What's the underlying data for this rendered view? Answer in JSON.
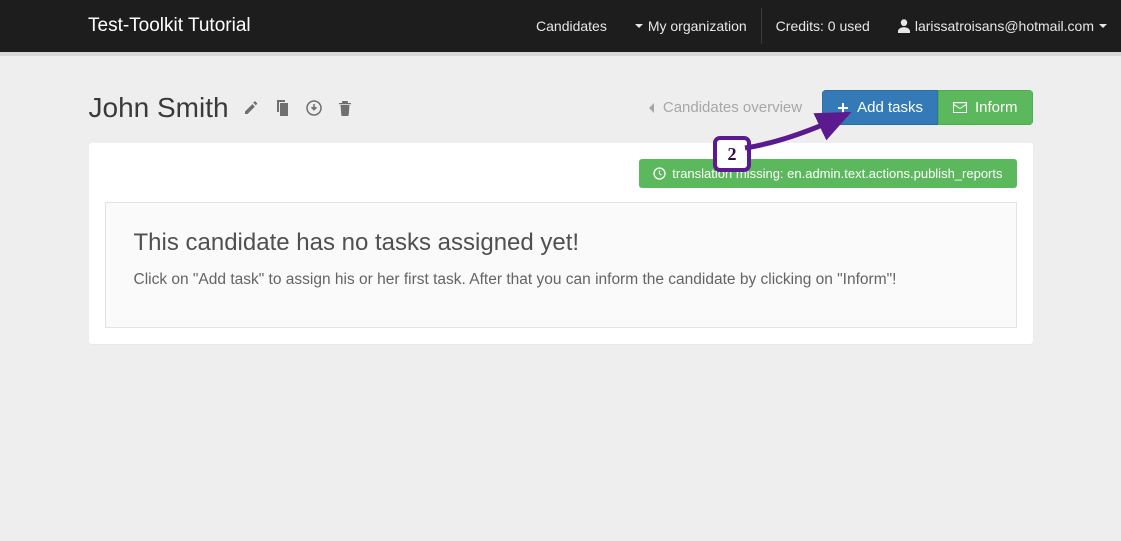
{
  "nav": {
    "brand": "Test-Toolkit Tutorial",
    "candidates": "Candidates",
    "my_org": "My organization",
    "credits": "Credits: 0 used",
    "user_email": "larissatroisans@hotmail.com"
  },
  "page": {
    "candidate_name": "John Smith",
    "back_label": "Candidates overview",
    "add_tasks_label": "Add tasks",
    "inform_label": "Inform",
    "ribbon_label": "translation missing: en.admin.text.actions.publish_reports"
  },
  "empty_state": {
    "heading": "This candidate has no tasks assigned yet!",
    "body": "Click on \"Add task\" to assign his or her first task. After that you can inform the candidate by clicking on \"Inform\"!"
  },
  "annotation": {
    "number": "2"
  }
}
